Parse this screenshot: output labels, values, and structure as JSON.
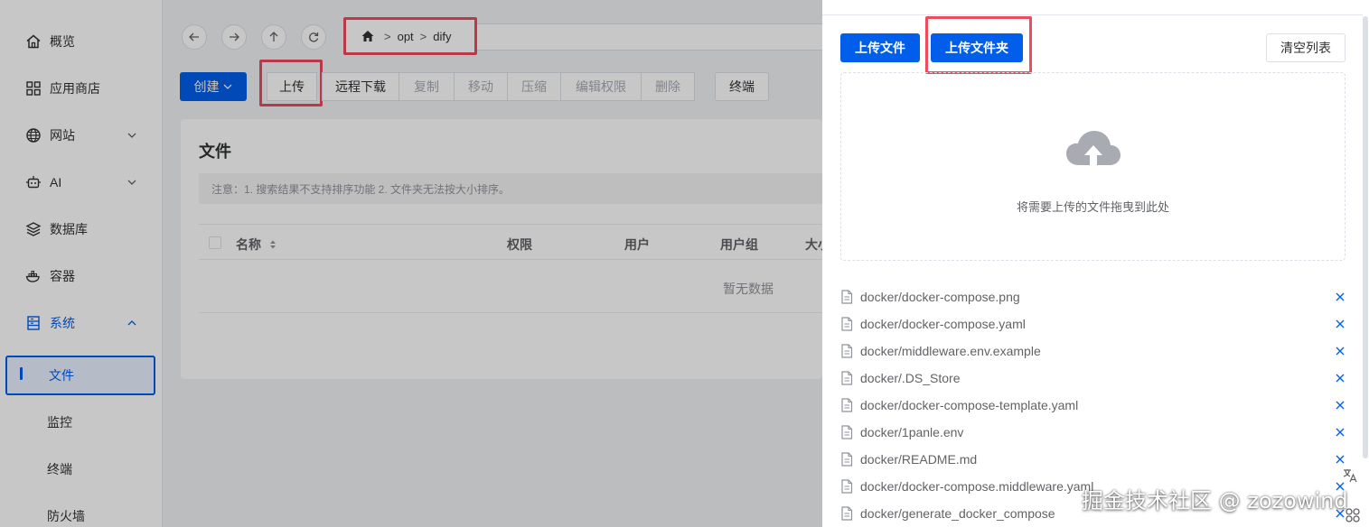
{
  "sidebar": {
    "items": [
      {
        "label": "概览",
        "icon": "home-icon"
      },
      {
        "label": "应用商店",
        "icon": "grid-icon"
      },
      {
        "label": "网站",
        "icon": "globe-icon"
      },
      {
        "label": "AI",
        "icon": "robot-icon"
      },
      {
        "label": "数据库",
        "icon": "layers-icon"
      },
      {
        "label": "容器",
        "icon": "docker-icon"
      },
      {
        "label": "系统",
        "icon": "server-icon"
      }
    ],
    "sub_items": [
      "文件",
      "监控",
      "终端",
      "防火墙"
    ]
  },
  "breadcrumb": {
    "parts": [
      "opt",
      "dify"
    ],
    "sep": ">"
  },
  "toolbar": {
    "create": "创建",
    "upload": "上传",
    "remote_download": "远程下载",
    "copy": "复制",
    "move": "移动",
    "compress": "压缩",
    "edit_permission": "编辑权限",
    "delete": "删除",
    "terminal": "终端"
  },
  "content": {
    "title": "文件",
    "notice": "注意：1. 搜索结果不支持排序功能 2. 文件夹无法按大小排序。",
    "columns": [
      "名称",
      "权限",
      "用户",
      "用户组",
      "大小"
    ],
    "empty": "暂无数据"
  },
  "drawer": {
    "upload_file": "上传文件",
    "upload_folder": "上传文件夹",
    "clear_list": "清空列表",
    "drop_text": "将需要上传的文件拖曳到此处",
    "files": [
      "docker/docker-compose.png",
      "docker/docker-compose.yaml",
      "docker/middleware.env.example",
      "docker/.DS_Store",
      "docker/docker-compose-template.yaml",
      "docker/1panle.env",
      "docker/README.md",
      "docker/docker-compose.middleware.yaml",
      "docker/generate_docker_compose"
    ]
  },
  "watermark": "掘金技术社区 @ zozowind",
  "colors": {
    "primary": "#005eeb",
    "highlight": "#ef4a5d"
  }
}
